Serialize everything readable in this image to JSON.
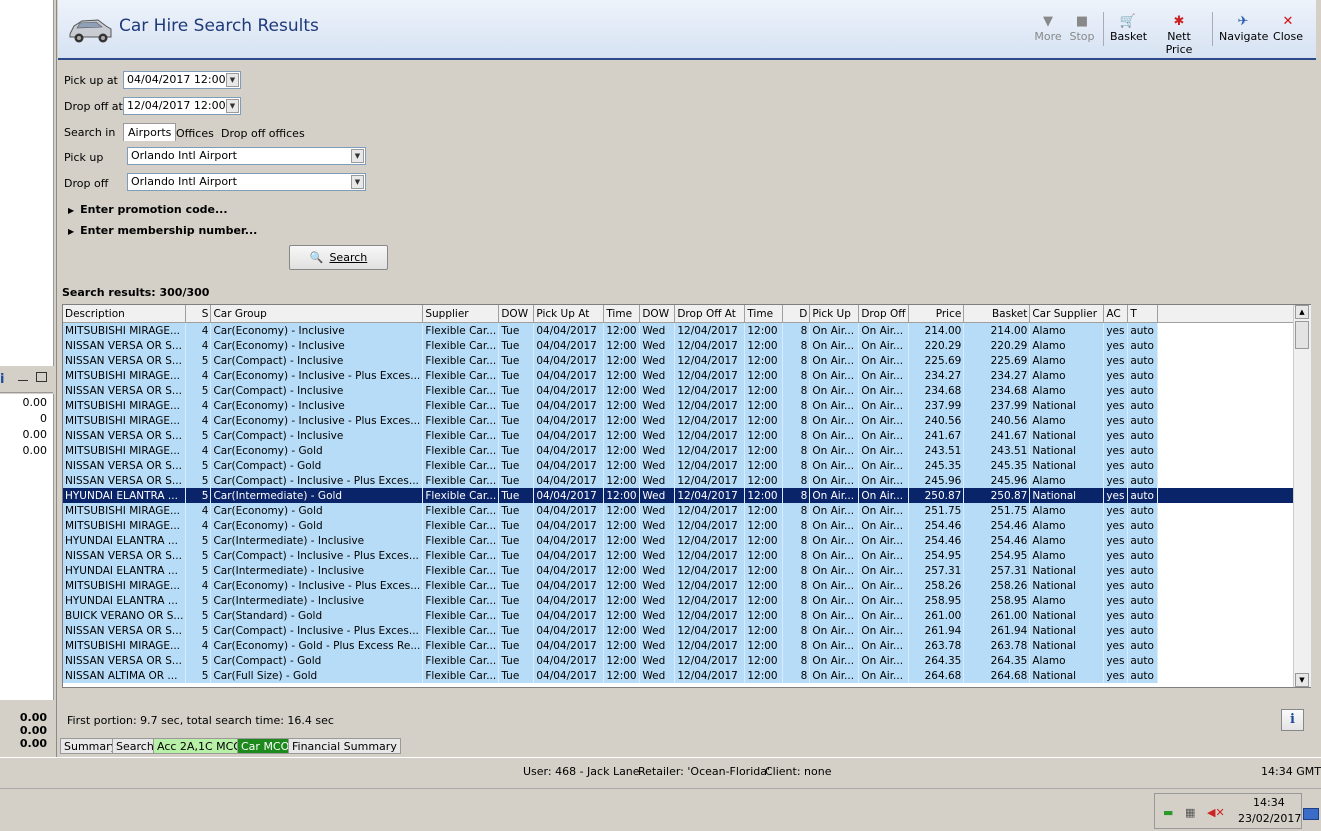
{
  "left_panel": {
    "values": [
      "0.00",
      "0",
      "0.00",
      "0.00"
    ],
    "totals": [
      "0.00",
      "0.00",
      "0.00"
    ]
  },
  "header": {
    "title": "Car Hire Search Results",
    "toolbar": [
      {
        "label": "More",
        "icon": "down-triangle-icon",
        "enabled": false
      },
      {
        "label": "Stop",
        "icon": "stop-icon",
        "enabled": false
      },
      {
        "label": "Basket",
        "icon": "basket-icon",
        "enabled": true
      },
      {
        "label": "Nett Price",
        "icon": "nett-price-icon",
        "enabled": true
      },
      {
        "label": "Navigate",
        "icon": "navigate-icon",
        "enabled": true
      },
      {
        "label": "Close",
        "icon": "close-icon",
        "enabled": true
      }
    ]
  },
  "form": {
    "pickup_at_label": "Pick up at",
    "pickup_at_value": "04/04/2017 12:00",
    "dropoff_at_label": "Drop off at",
    "dropoff_at_value": "12/04/2017 12:00",
    "search_in_label": "Search in",
    "search_in_tabs": [
      "Airports",
      "Offices",
      "Drop off offices"
    ],
    "pickup_label": "Pick up",
    "pickup_value": "Orlando Intl Airport",
    "dropoff_label": "Drop off",
    "dropoff_value": "Orlando Intl Airport",
    "promotion_label": "Enter promotion code...",
    "membership_label": "Enter membership number...",
    "search_button": "Search"
  },
  "results": {
    "label": "Search results: 300/300",
    "columns": [
      "Description",
      "S",
      "Car Group",
      "Supplier",
      "DOW",
      "Pick Up At",
      "Time",
      "DOW",
      "Drop Off At",
      "Time",
      "D",
      "Pick Up",
      "Drop Off",
      "Price",
      "Basket",
      "Car Supplier",
      "AC",
      "T"
    ],
    "selected_index": 11,
    "rows": [
      [
        "MITSUBISHI MIRAGE...",
        "4",
        "Car(Economy) - Inclusive",
        "Flexible Car...",
        "Tue",
        "04/04/2017",
        "12:00",
        "Wed",
        "12/04/2017",
        "12:00",
        "8",
        "On Air...",
        "On Air...",
        "214.00",
        "214.00",
        "Alamo",
        "yes",
        "auto"
      ],
      [
        "NISSAN VERSA OR S...",
        "4",
        "Car(Economy) - Inclusive",
        "Flexible Car...",
        "Tue",
        "04/04/2017",
        "12:00",
        "Wed",
        "12/04/2017",
        "12:00",
        "8",
        "On Air...",
        "On Air...",
        "220.29",
        "220.29",
        "Alamo",
        "yes",
        "auto"
      ],
      [
        "NISSAN VERSA OR S...",
        "5",
        "Car(Compact) - Inclusive",
        "Flexible Car...",
        "Tue",
        "04/04/2017",
        "12:00",
        "Wed",
        "12/04/2017",
        "12:00",
        "8",
        "On Air...",
        "On Air...",
        "225.69",
        "225.69",
        "Alamo",
        "yes",
        "auto"
      ],
      [
        "MITSUBISHI MIRAGE...",
        "4",
        "Car(Economy) - Inclusive - Plus Exces...",
        "Flexible Car...",
        "Tue",
        "04/04/2017",
        "12:00",
        "Wed",
        "12/04/2017",
        "12:00",
        "8",
        "On Air...",
        "On Air...",
        "234.27",
        "234.27",
        "Alamo",
        "yes",
        "auto"
      ],
      [
        "NISSAN VERSA OR S...",
        "5",
        "Car(Compact) - Inclusive",
        "Flexible Car...",
        "Tue",
        "04/04/2017",
        "12:00",
        "Wed",
        "12/04/2017",
        "12:00",
        "8",
        "On Air...",
        "On Air...",
        "234.68",
        "234.68",
        "Alamo",
        "yes",
        "auto"
      ],
      [
        "MITSUBISHI MIRAGE...",
        "4",
        "Car(Economy) - Inclusive",
        "Flexible Car...",
        "Tue",
        "04/04/2017",
        "12:00",
        "Wed",
        "12/04/2017",
        "12:00",
        "8",
        "On Air...",
        "On Air...",
        "237.99",
        "237.99",
        "National",
        "yes",
        "auto"
      ],
      [
        "MITSUBISHI MIRAGE...",
        "4",
        "Car(Economy) - Inclusive - Plus Exces...",
        "Flexible Car...",
        "Tue",
        "04/04/2017",
        "12:00",
        "Wed",
        "12/04/2017",
        "12:00",
        "8",
        "On Air...",
        "On Air...",
        "240.56",
        "240.56",
        "Alamo",
        "yes",
        "auto"
      ],
      [
        "NISSAN VERSA OR S...",
        "5",
        "Car(Compact) - Inclusive",
        "Flexible Car...",
        "Tue",
        "04/04/2017",
        "12:00",
        "Wed",
        "12/04/2017",
        "12:00",
        "8",
        "On Air...",
        "On Air...",
        "241.67",
        "241.67",
        "National",
        "yes",
        "auto"
      ],
      [
        "MITSUBISHI MIRAGE...",
        "4",
        "Car(Economy) - Gold",
        "Flexible Car...",
        "Tue",
        "04/04/2017",
        "12:00",
        "Wed",
        "12/04/2017",
        "12:00",
        "8",
        "On Air...",
        "On Air...",
        "243.51",
        "243.51",
        "National",
        "yes",
        "auto"
      ],
      [
        "NISSAN VERSA OR S...",
        "5",
        "Car(Compact) - Gold",
        "Flexible Car...",
        "Tue",
        "04/04/2017",
        "12:00",
        "Wed",
        "12/04/2017",
        "12:00",
        "8",
        "On Air...",
        "On Air...",
        "245.35",
        "245.35",
        "National",
        "yes",
        "auto"
      ],
      [
        "NISSAN VERSA OR S...",
        "5",
        "Car(Compact) - Inclusive - Plus Exces...",
        "Flexible Car...",
        "Tue",
        "04/04/2017",
        "12:00",
        "Wed",
        "12/04/2017",
        "12:00",
        "8",
        "On Air...",
        "On Air...",
        "245.96",
        "245.96",
        "Alamo",
        "yes",
        "auto"
      ],
      [
        "HYUNDAI ELANTRA ...",
        "5",
        "Car(Intermediate) - Gold",
        "Flexible Car...",
        "Tue",
        "04/04/2017",
        "12:00",
        "Wed",
        "12/04/2017",
        "12:00",
        "8",
        "On Air...",
        "On Air...",
        "250.87",
        "250.87",
        "National",
        "yes",
        "auto"
      ],
      [
        "MITSUBISHI MIRAGE...",
        "4",
        "Car(Economy) - Gold",
        "Flexible Car...",
        "Tue",
        "04/04/2017",
        "12:00",
        "Wed",
        "12/04/2017",
        "12:00",
        "8",
        "On Air...",
        "On Air...",
        "251.75",
        "251.75",
        "Alamo",
        "yes",
        "auto"
      ],
      [
        "MITSUBISHI MIRAGE...",
        "4",
        "Car(Economy) - Gold",
        "Flexible Car...",
        "Tue",
        "04/04/2017",
        "12:00",
        "Wed",
        "12/04/2017",
        "12:00",
        "8",
        "On Air...",
        "On Air...",
        "254.46",
        "254.46",
        "Alamo",
        "yes",
        "auto"
      ],
      [
        "HYUNDAI ELANTRA ...",
        "5",
        "Car(Intermediate) - Inclusive",
        "Flexible Car...",
        "Tue",
        "04/04/2017",
        "12:00",
        "Wed",
        "12/04/2017",
        "12:00",
        "8",
        "On Air...",
        "On Air...",
        "254.46",
        "254.46",
        "Alamo",
        "yes",
        "auto"
      ],
      [
        "NISSAN VERSA OR S...",
        "5",
        "Car(Compact) - Inclusive - Plus Exces...",
        "Flexible Car...",
        "Tue",
        "04/04/2017",
        "12:00",
        "Wed",
        "12/04/2017",
        "12:00",
        "8",
        "On Air...",
        "On Air...",
        "254.95",
        "254.95",
        "Alamo",
        "yes",
        "auto"
      ],
      [
        "HYUNDAI ELANTRA ...",
        "5",
        "Car(Intermediate) - Inclusive",
        "Flexible Car...",
        "Tue",
        "04/04/2017",
        "12:00",
        "Wed",
        "12/04/2017",
        "12:00",
        "8",
        "On Air...",
        "On Air...",
        "257.31",
        "257.31",
        "National",
        "yes",
        "auto"
      ],
      [
        "MITSUBISHI MIRAGE...",
        "4",
        "Car(Economy) - Inclusive - Plus Exces...",
        "Flexible Car...",
        "Tue",
        "04/04/2017",
        "12:00",
        "Wed",
        "12/04/2017",
        "12:00",
        "8",
        "On Air...",
        "On Air...",
        "258.26",
        "258.26",
        "National",
        "yes",
        "auto"
      ],
      [
        "HYUNDAI ELANTRA ...",
        "5",
        "Car(Intermediate) - Inclusive",
        "Flexible Car...",
        "Tue",
        "04/04/2017",
        "12:00",
        "Wed",
        "12/04/2017",
        "12:00",
        "8",
        "On Air...",
        "On Air...",
        "258.95",
        "258.95",
        "Alamo",
        "yes",
        "auto"
      ],
      [
        "BUICK VERANO OR S...",
        "5",
        "Car(Standard) - Gold",
        "Flexible Car...",
        "Tue",
        "04/04/2017",
        "12:00",
        "Wed",
        "12/04/2017",
        "12:00",
        "8",
        "On Air...",
        "On Air...",
        "261.00",
        "261.00",
        "National",
        "yes",
        "auto"
      ],
      [
        "NISSAN VERSA OR S...",
        "5",
        "Car(Compact) - Inclusive - Plus Exces...",
        "Flexible Car...",
        "Tue",
        "04/04/2017",
        "12:00",
        "Wed",
        "12/04/2017",
        "12:00",
        "8",
        "On Air...",
        "On Air...",
        "261.94",
        "261.94",
        "National",
        "yes",
        "auto"
      ],
      [
        "MITSUBISHI MIRAGE...",
        "4",
        "Car(Economy) - Gold - Plus Excess Re...",
        "Flexible Car...",
        "Tue",
        "04/04/2017",
        "12:00",
        "Wed",
        "12/04/2017",
        "12:00",
        "8",
        "On Air...",
        "On Air...",
        "263.78",
        "263.78",
        "National",
        "yes",
        "auto"
      ],
      [
        "NISSAN VERSA OR S...",
        "5",
        "Car(Compact) - Gold",
        "Flexible Car...",
        "Tue",
        "04/04/2017",
        "12:00",
        "Wed",
        "12/04/2017",
        "12:00",
        "8",
        "On Air...",
        "On Air...",
        "264.35",
        "264.35",
        "Alamo",
        "yes",
        "auto"
      ],
      [
        "NISSAN ALTIMA OR ...",
        "5",
        "Car(Full Size) - Gold",
        "Flexible Car...",
        "Tue",
        "04/04/2017",
        "12:00",
        "Wed",
        "12/04/2017",
        "12:00",
        "8",
        "On Air...",
        "On Air...",
        "264.68",
        "264.68",
        "National",
        "yes",
        "auto"
      ]
    ]
  },
  "timing": "First portion: 9.7 sec, total search time: 16.4 sec",
  "info_button": "i",
  "bottom_tabs": [
    "Summary",
    "Search",
    "Acc 2A,1C MCO",
    "Car MCO",
    "Financial Summary"
  ],
  "status": {
    "user": "User: 468 - Jack Lane",
    "retailer": "Retailer: 'Ocean-Florida'",
    "client": "Client: none",
    "time": "14:34 GMT"
  },
  "taskbar": {
    "clock_time": "14:34",
    "clock_date": "23/02/2017"
  }
}
